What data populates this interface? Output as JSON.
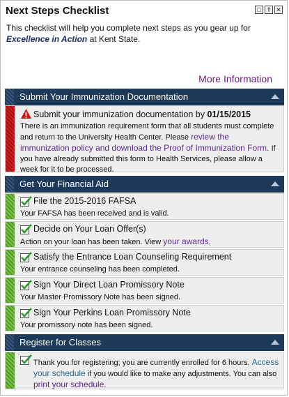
{
  "header": {
    "title": "Next Steps Checklist"
  },
  "window_buttons": [
    "□",
    "⇑",
    "✕"
  ],
  "intro": {
    "pre": "This checklist will help you complete next steps as you gear up for",
    "em": "Excellence in Action",
    "post": " at Kent State."
  },
  "more_info": "More Information",
  "sections": [
    {
      "title": "Submit Your Immunization Documentation"
    },
    {
      "title": "Get Your Financial Aid"
    },
    {
      "title": "Register for Classes"
    }
  ],
  "immunization": {
    "title_pre": "Submit your immunization documentation by ",
    "date": "01/15/2015",
    "desc_pre": "There is an immunization requirement form that all students must complete and return to the University Health Center. Please ",
    "link": "review the immunization policy and download the Proof of Immunization Form.",
    "desc_post": " If you have already submitted this form to Health Services, please allow a week for it to be processed."
  },
  "aid": [
    {
      "title": "File the 2015-2016 FAFSA",
      "desc": "Your FAFSA has been received and is valid."
    },
    {
      "title": "Decide on Your Loan Offer(s)",
      "desc": "Action on your loan has been taken. View ",
      "link": "your awards",
      "desc_post": "."
    },
    {
      "title": "Satisfy the Entrance Loan Counseling Requirement",
      "desc": "Your entrance counseling has been completed."
    },
    {
      "title": "Sign Your Direct Loan Promissory Note",
      "desc": "Your Master Promissory Note has been signed."
    },
    {
      "title": "Sign Your Perkins Loan Promissory Note",
      "desc": "Your promissory note has been signed."
    }
  ],
  "register": {
    "desc_pre": "Thank you for registering; you are currently enrolled for 6 hours. ",
    "link1": "Access your schedule",
    "mid": " if you would like to make any adjustments. You can also ",
    "link2": "print your schedule",
    "post": "."
  }
}
